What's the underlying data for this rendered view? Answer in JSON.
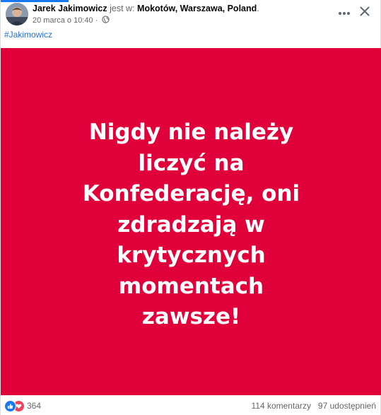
{
  "post": {
    "author": "Jarek Jakimowicz",
    "location_prefix": "jest w:",
    "location": "Mokotów, Warszawa, Poland",
    "location_suffix": ".",
    "date": "20 marca o 10:40",
    "meta_separator": "·",
    "privacy_icon": "globe-icon",
    "hashtag": "#Jakimowicz",
    "image_text": "Nigdy nie należy liczyć na Konfederację, oni zdradzają w krytycznych momentach zawsze!",
    "image_background": "#e0003a"
  },
  "header": {
    "more_icon": "more-horizontal-icon",
    "close_icon": "close-icon"
  },
  "footer": {
    "reactions": [
      "like",
      "love"
    ],
    "reaction_count": "364",
    "comments": "114 komentarzy",
    "shares": "97 udostępnień"
  },
  "colors": {
    "accent": "#1877f2",
    "link": "#216fdb",
    "like": "#1877f2",
    "love": "#f33e58"
  }
}
